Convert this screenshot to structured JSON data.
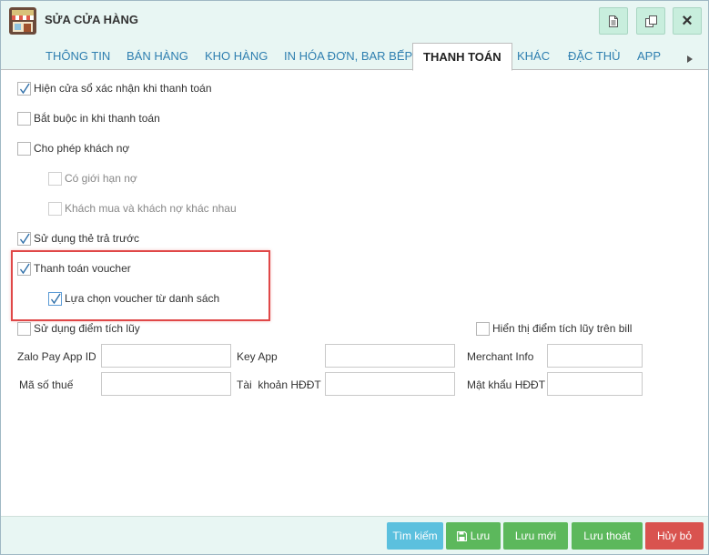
{
  "window": {
    "title": "SỬA CỬA HÀNG",
    "app_icon": "store-icon",
    "buttons": [
      {
        "name": "document-icon"
      },
      {
        "name": "copy-icon"
      },
      {
        "name": "close-icon",
        "label": "×"
      }
    ]
  },
  "tabs": [
    {
      "label": "THÔNG TIN",
      "active": false
    },
    {
      "label": "BÁN HÀNG",
      "active": false
    },
    {
      "label": "KHO HÀNG",
      "active": false
    },
    {
      "label": "IN HÓA ĐƠN, BAR BẾP",
      "active": false
    },
    {
      "label": "THANH TOÁN",
      "active": true
    },
    {
      "label": "KHÁC",
      "active": false
    },
    {
      "label": "ĐẶC THÙ",
      "active": false
    },
    {
      "label": "APP",
      "active": false
    }
  ],
  "options": {
    "confirm_window": {
      "label": "Hiện cửa sổ xác nhận khi thanh toán",
      "checked": true
    },
    "force_print": {
      "label": "Bắt buộc in khi thanh toán",
      "checked": false
    },
    "allow_debt": {
      "label": "Cho phép khách nợ",
      "checked": false
    },
    "debt_limit": {
      "label": "Có giới hạn nợ",
      "checked": false,
      "disabled": true
    },
    "buyer_debtor_diff": {
      "label": "Khách mua và khách nợ khác nhau",
      "checked": false,
      "disabled": true
    },
    "prepaid_card": {
      "label": "Sử dụng thẻ trả trước",
      "checked": true
    },
    "voucher_payment": {
      "label": "Thanh toán voucher",
      "checked": true
    },
    "voucher_from_list": {
      "label": "Lựa chọn voucher từ danh sách",
      "checked": true
    },
    "use_points": {
      "label": "Sử dụng điểm tích lũy",
      "checked": false
    },
    "show_points_on_bill": {
      "label": "Hiển thị điểm tích lũy trên bill",
      "checked": false
    }
  },
  "fields": {
    "zalo_app_id": {
      "label": "Zalo Pay App ID",
      "value": ""
    },
    "key_app": {
      "label": "Key App",
      "value": ""
    },
    "merchant_info": {
      "label": "Merchant Info",
      "value": ""
    },
    "tax_code": {
      "label": "Mã số thuế",
      "value": ""
    },
    "einvoice_account": {
      "label": "Tài  khoản HĐĐT",
      "value": ""
    },
    "einvoice_password": {
      "label": "Mật khẩu HĐĐT",
      "value": ""
    }
  },
  "footer": {
    "search": "Tìm kiếm",
    "save": "Lưu",
    "save_new": "Lưu mới",
    "save_exit": "Lưu thoát",
    "cancel": "Hủy bỏ"
  },
  "colors": {
    "header_bg": "#e8f6f3",
    "tab_text": "#2f7fb0",
    "highlight": "#e04848",
    "btn_info": "#5bc0de",
    "btn_success": "#5cb85c",
    "btn_danger": "#d9534f"
  }
}
